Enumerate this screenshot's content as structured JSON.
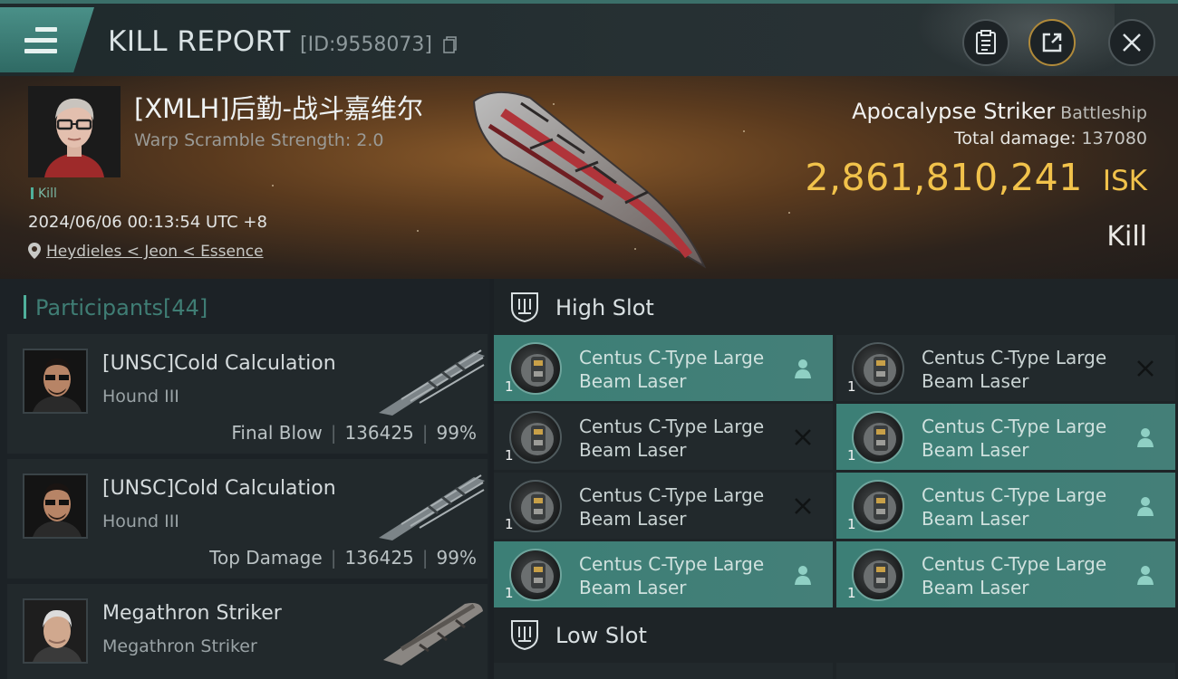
{
  "header": {
    "title": "KILL REPORT",
    "id_text": "[ID:9558073]",
    "buttons": {
      "clipboard": "clipboard-icon",
      "share": "share-icon",
      "close": "close-icon"
    }
  },
  "victim": {
    "name": "[XMLH]后勤-战斗嘉维尔",
    "warp": "Warp Scramble Strength: 2.0",
    "badge": "Kill",
    "timestamp": "2024/06/06 00:13:54 UTC +8",
    "location": "Heydieles < Jeon < Essence"
  },
  "ship": {
    "name": "Apocalypse Striker",
    "class": "Battleship",
    "total_damage_label": "Total damage:",
    "total_damage": "137080",
    "isk_value": "2,861,810,241",
    "isk_unit": "ISK",
    "result": "Kill"
  },
  "participants": {
    "label": "Participants",
    "count": "[44]",
    "items": [
      {
        "name": "[UNSC]Cold Calculation",
        "ship": "Hound III",
        "role": "Final Blow",
        "damage": "136425",
        "percent": "99%"
      },
      {
        "name": "[UNSC]Cold Calculation",
        "ship": "Hound III",
        "role": "Top Damage",
        "damage": "136425",
        "percent": "99%"
      },
      {
        "name": "Megathron Striker",
        "ship": "Megathron Striker"
      }
    ]
  },
  "slots": {
    "high": {
      "label": "High Slot",
      "modules": [
        {
          "line1": "Centus C-Type Large",
          "line2": "Beam Laser",
          "qty": "1",
          "state": "active"
        },
        {
          "line1": "Centus C-Type Large",
          "line2": "Beam Laser",
          "qty": "1",
          "state": "destroyed"
        },
        {
          "line1": "Centus C-Type Large",
          "line2": "Beam Laser",
          "qty": "1",
          "state": "destroyed"
        },
        {
          "line1": "Centus C-Type Large",
          "line2": "Beam Laser",
          "qty": "1",
          "state": "active"
        },
        {
          "line1": "Centus C-Type Large",
          "line2": "Beam Laser",
          "qty": "1",
          "state": "destroyed"
        },
        {
          "line1": "Centus C-Type Large",
          "line2": "Beam Laser",
          "qty": "1",
          "state": "active"
        },
        {
          "line1": "Centus C-Type Large",
          "line2": "Beam Laser",
          "qty": "1",
          "state": "active"
        },
        {
          "line1": "Centus C-Type Large",
          "line2": "Beam Laser",
          "qty": "1",
          "state": "active"
        }
      ]
    },
    "low": {
      "label": "Low Slot"
    }
  },
  "colors": {
    "accent": "#4fb09b",
    "isk": "#f1c24b",
    "module_active": "#3c7f76"
  }
}
